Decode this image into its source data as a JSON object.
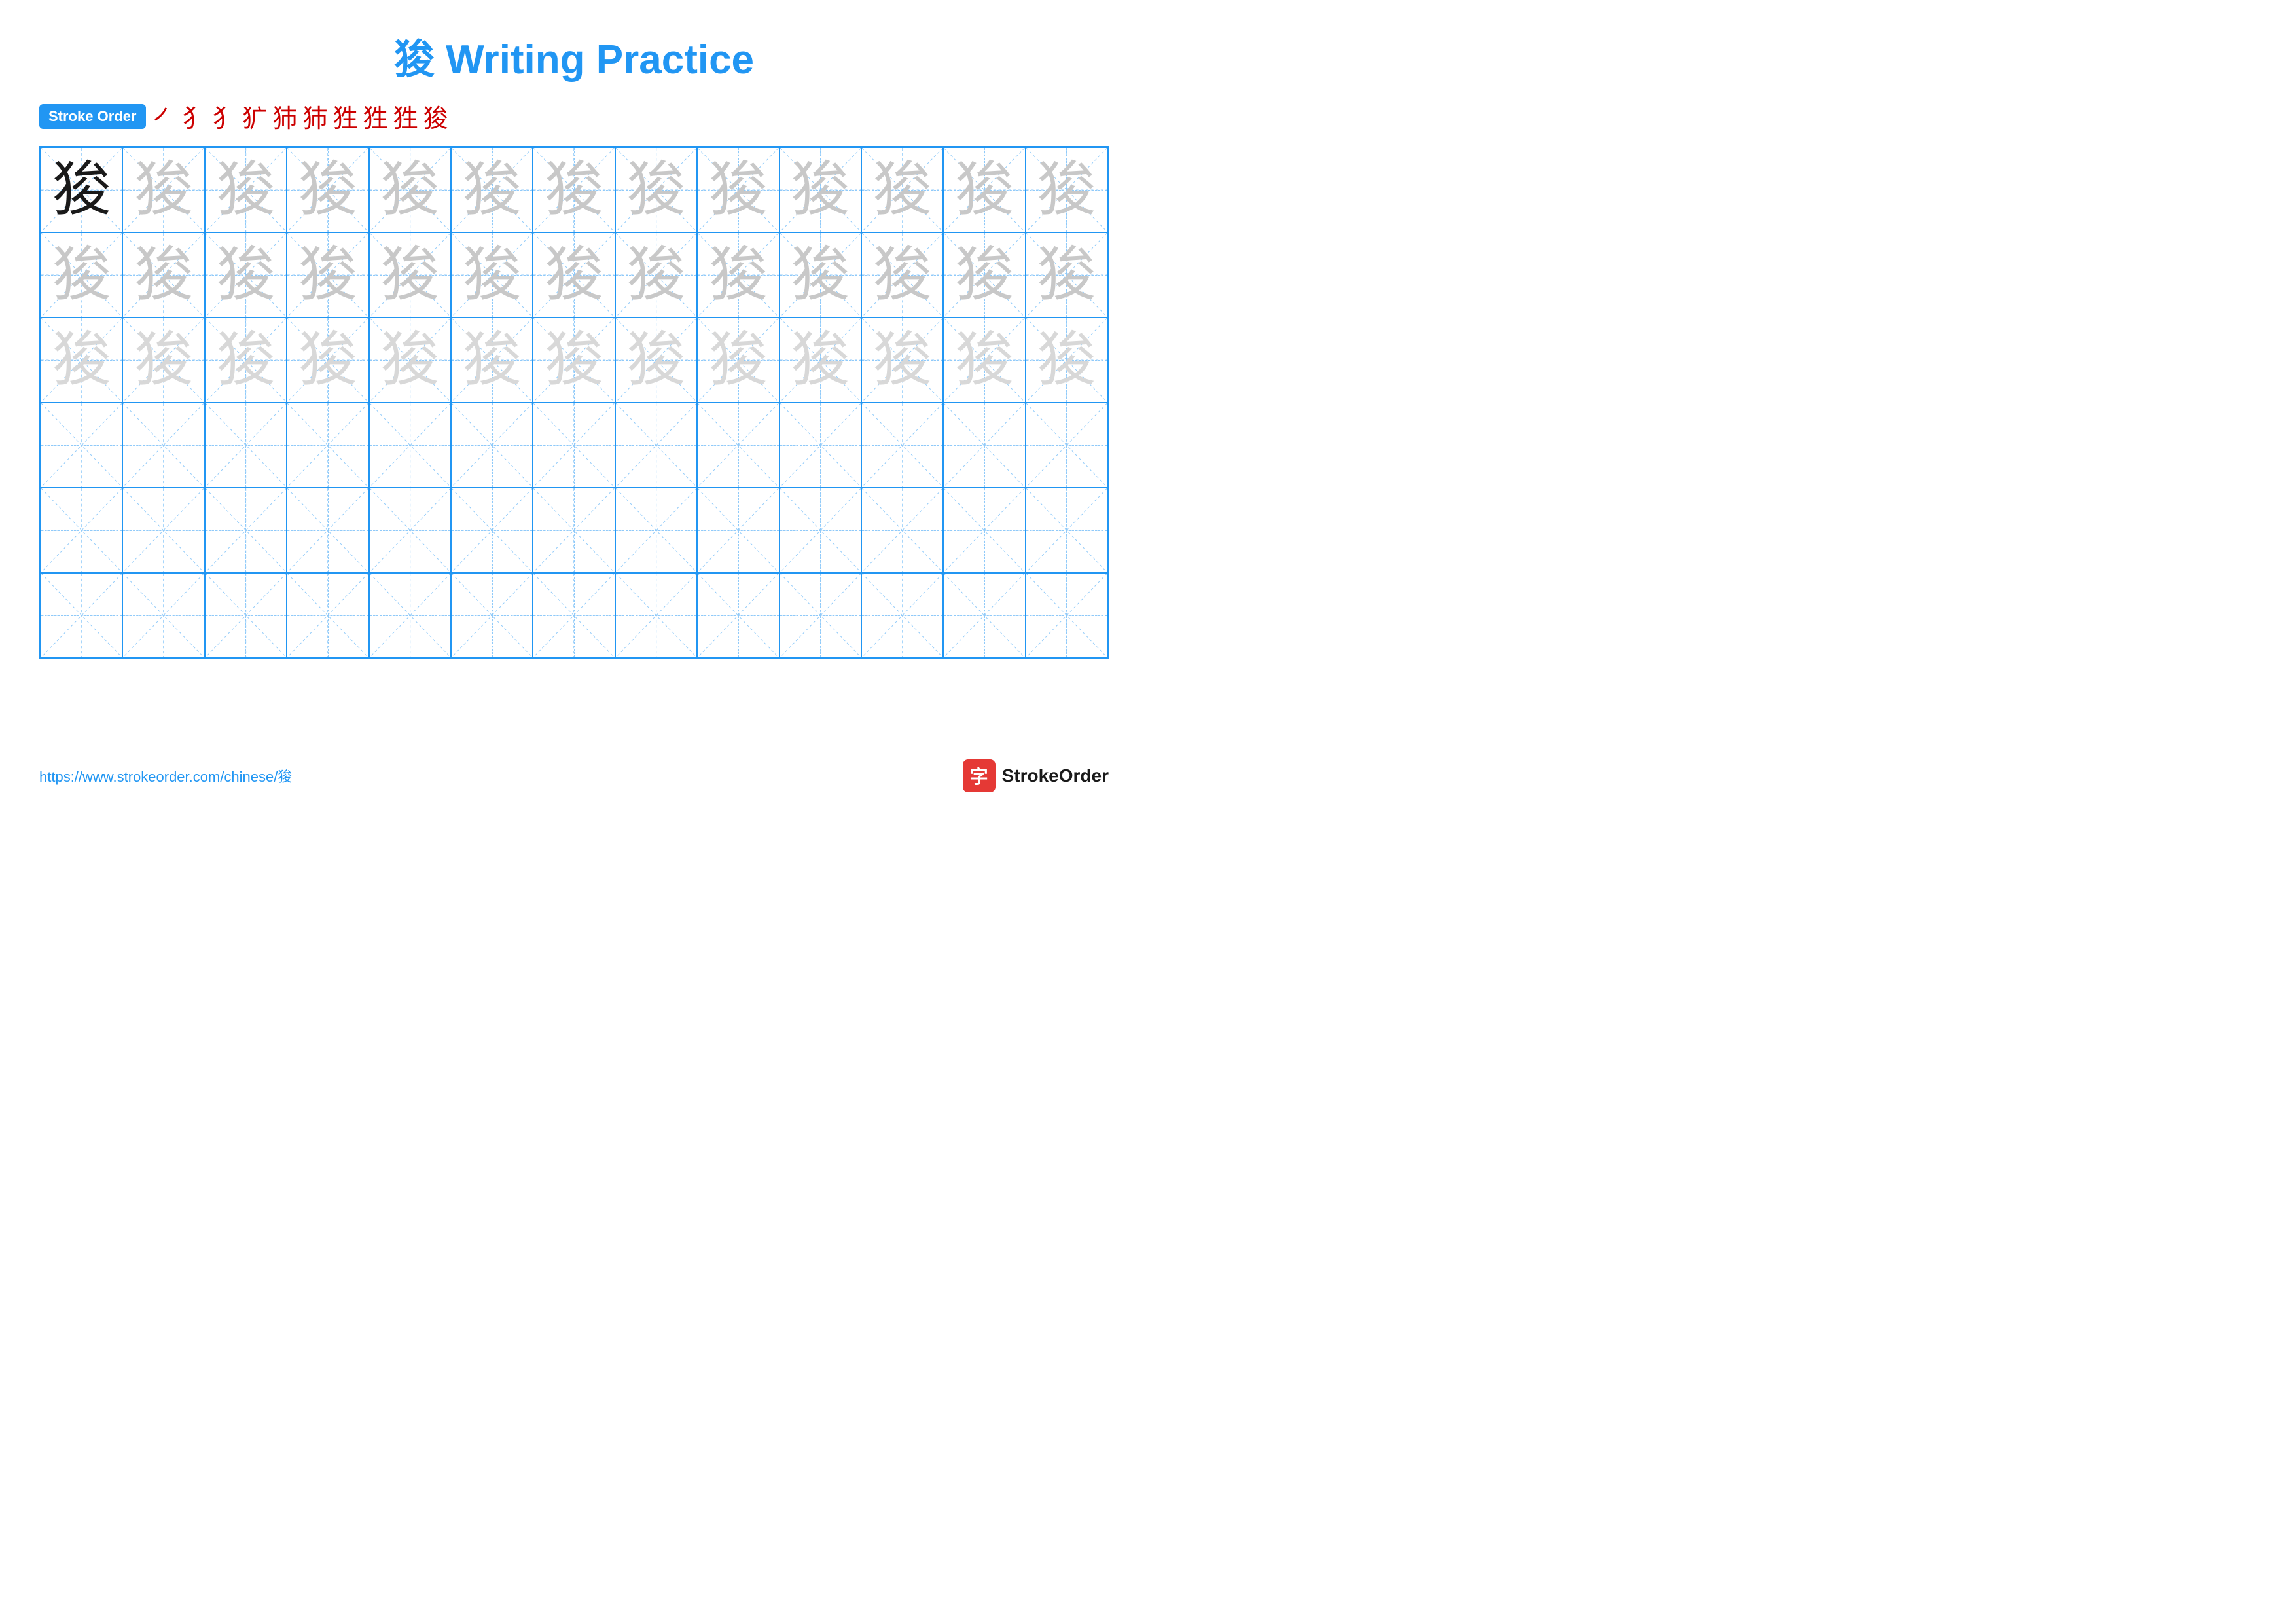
{
  "title": "狻 Writing Practice",
  "stroke_order_label": "Stroke Order",
  "stroke_sequence": [
    "㇒",
    "犭",
    "犭",
    "犷",
    "犻",
    "犻",
    "狌",
    "狌",
    "狌",
    "狻"
  ],
  "character": "狻",
  "footer_url": "https://www.strokeorder.com/chinese/狻",
  "footer_logo_text": "StrokeOrder",
  "rows": [
    {
      "type": "dark_then_light1",
      "dark_count": 1,
      "total": 13
    },
    {
      "type": "light1",
      "total": 13
    },
    {
      "type": "light2",
      "total": 13
    },
    {
      "type": "empty",
      "total": 13
    },
    {
      "type": "empty",
      "total": 13
    },
    {
      "type": "empty",
      "total": 13
    }
  ]
}
